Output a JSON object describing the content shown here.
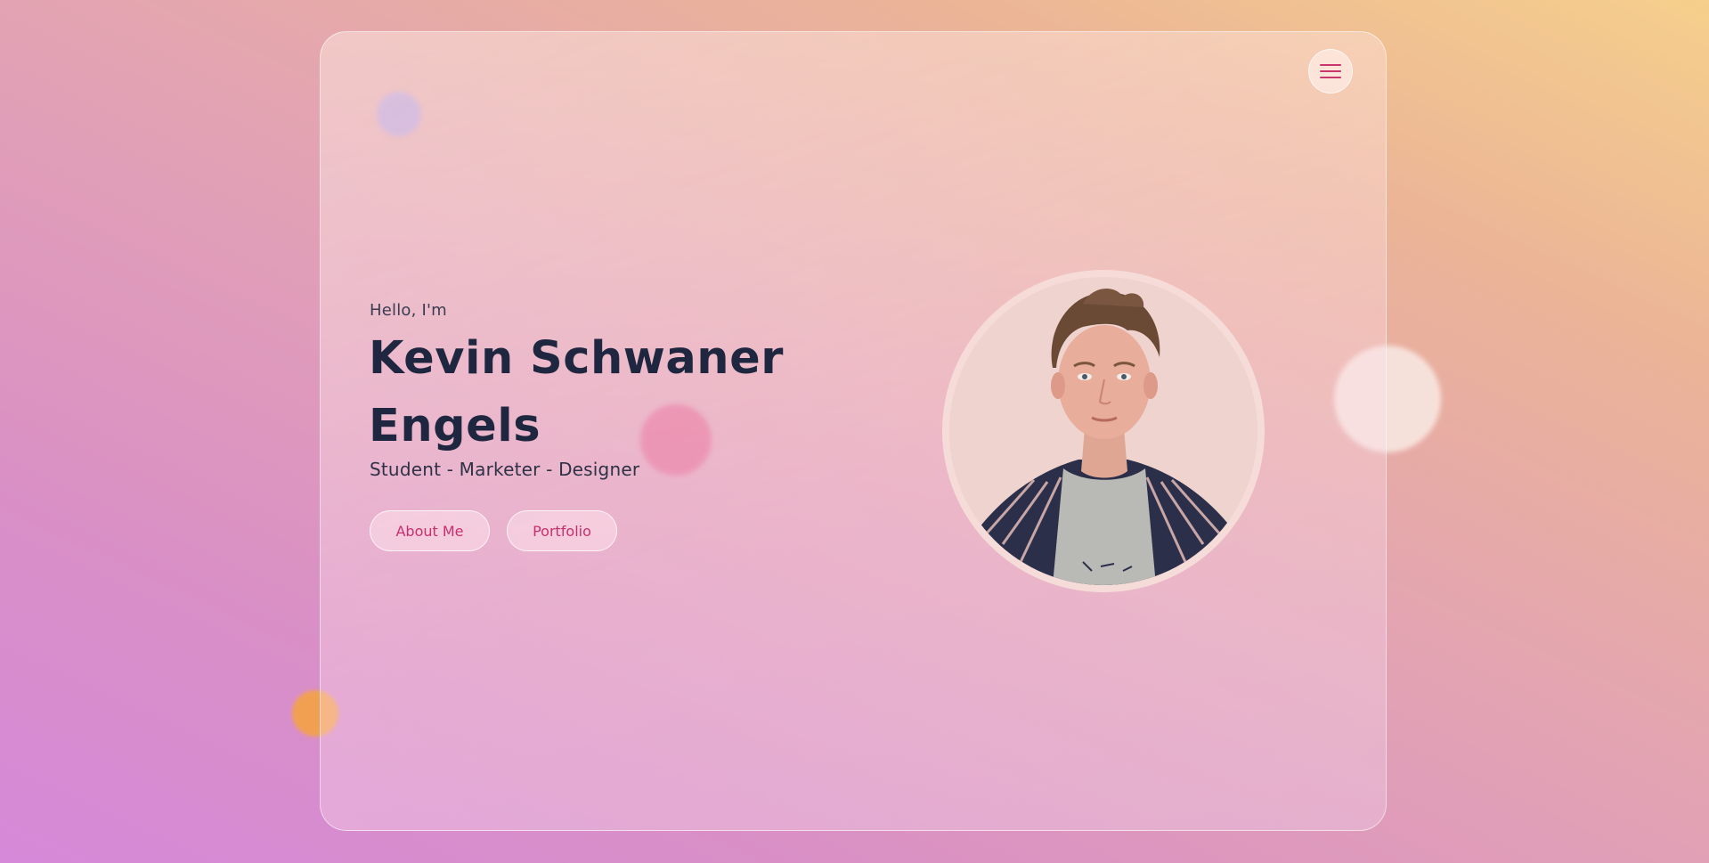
{
  "hero": {
    "greeting": "Hello, I'm",
    "name": "Kevin Schwaner Engels",
    "subtitle": "Student - Marketer - Designer",
    "buttons": {
      "about": "About Me",
      "portfolio": "Portfolio"
    }
  },
  "nav": {
    "menu_icon": "hamburger-menu-icon"
  },
  "portrait": {
    "description": "profile-photo"
  },
  "colors": {
    "accent": "#c72f6f",
    "heading": "#1f2740",
    "text": "#2f3147",
    "background_top_right": "#f6cf8c",
    "background_bottom_left": "#d589d9"
  }
}
